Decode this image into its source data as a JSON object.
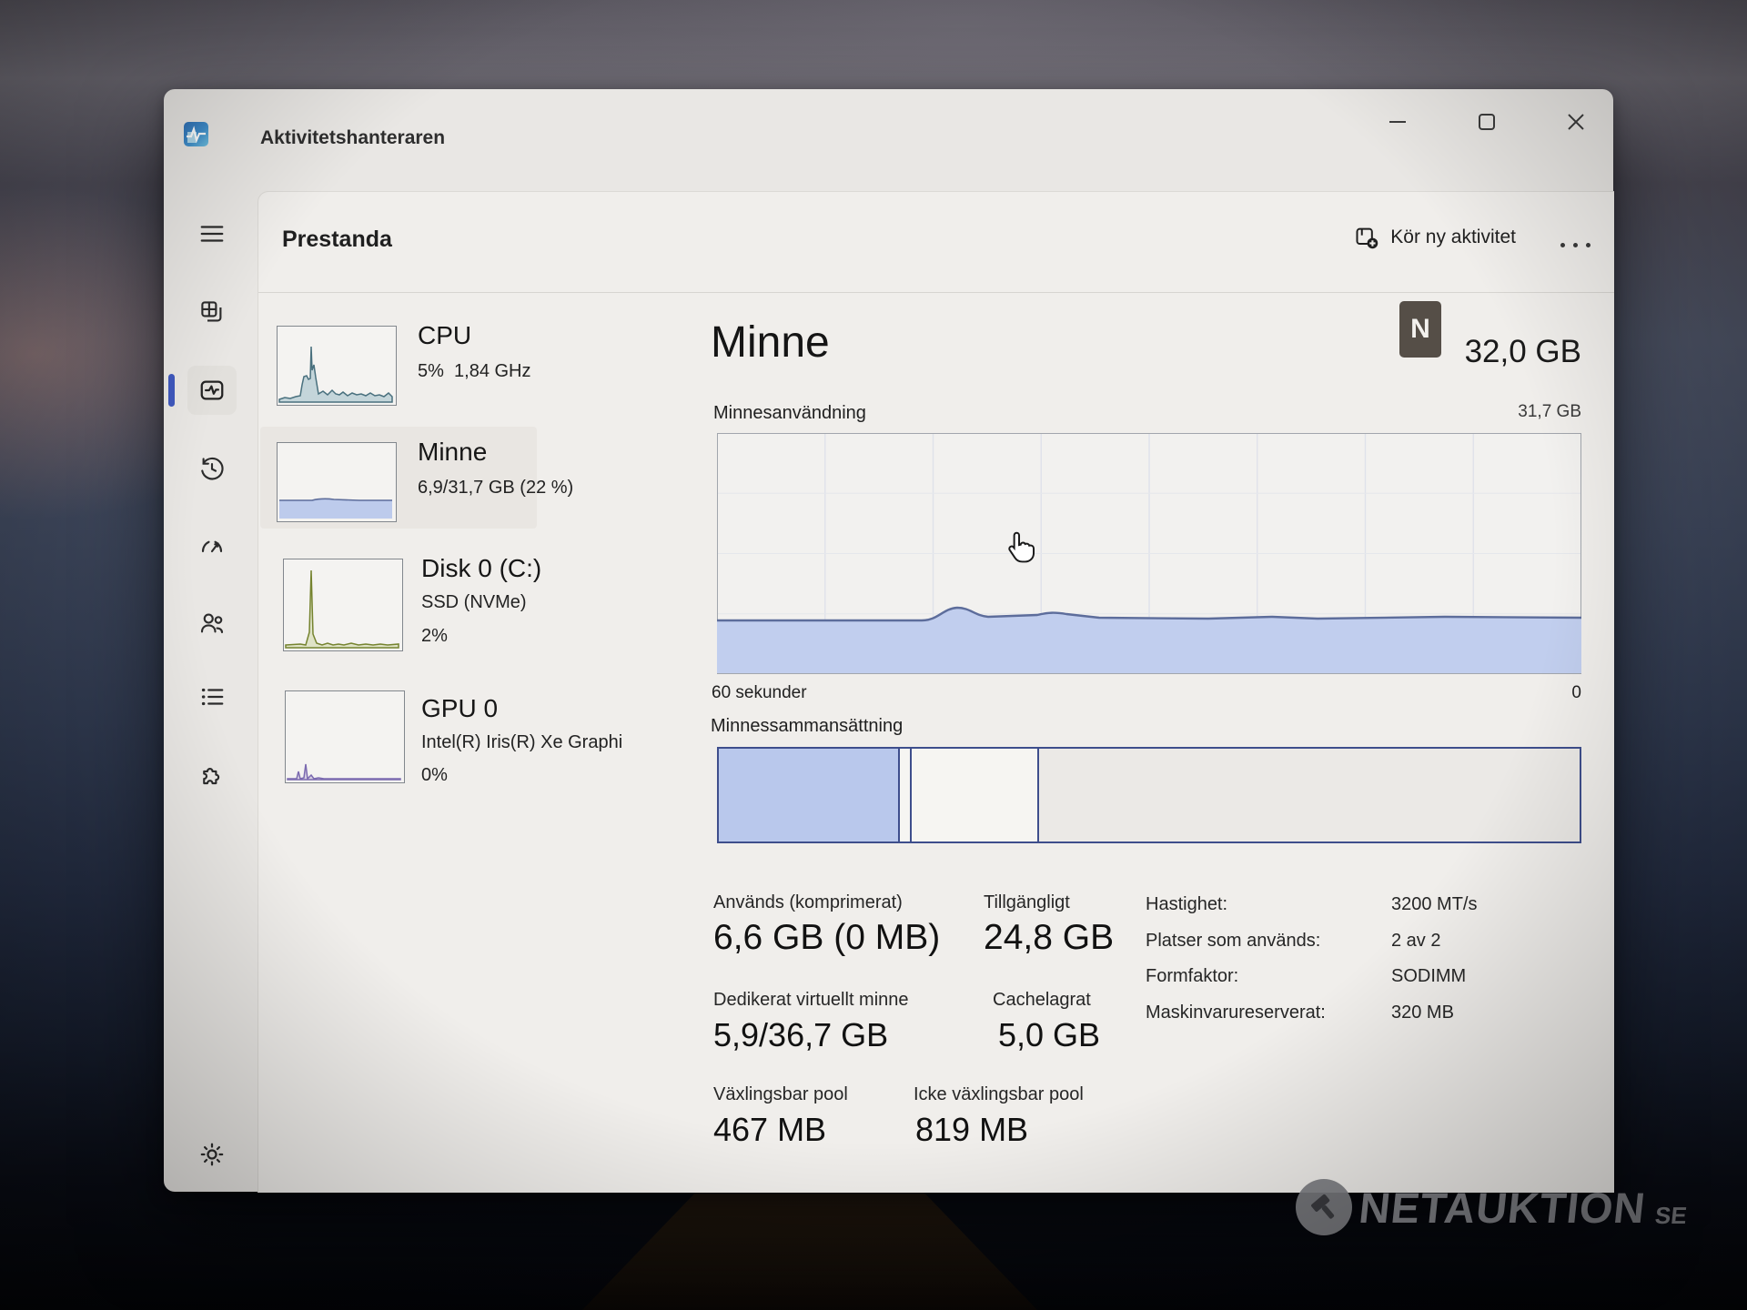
{
  "colors": {
    "accent_blue": "#3f58bd",
    "memory_fill": "#bdcbec",
    "memory_line": "#5d6d9b",
    "cpu_line": "#49707e",
    "disk_line": "#75832f",
    "gpu_line": "#7b6ab0",
    "composition_border": "#3e4e8c",
    "window_bg": "#e9e7e4"
  },
  "titlebar": {
    "title": "Aktivitetshanteraren"
  },
  "sidebar": {
    "items": [
      {
        "icon": "menu-icon"
      },
      {
        "icon": "processes-icon"
      },
      {
        "icon": "performance-icon",
        "selected": true
      },
      {
        "icon": "app-history-icon"
      },
      {
        "icon": "startup-apps-icon"
      },
      {
        "icon": "users-icon"
      },
      {
        "icon": "details-icon"
      },
      {
        "icon": "services-icon"
      },
      {
        "icon": "settings-icon"
      }
    ]
  },
  "panel": {
    "title": "Prestanda",
    "run_new_task": "Kör ny aktivitet"
  },
  "perf_items": [
    {
      "title": "CPU",
      "line1": "5%  1,84 GHz",
      "line2": ""
    },
    {
      "title": "Minne",
      "line1": "6,9/31,7 GB (22 %)",
      "line2": ""
    },
    {
      "title": "Disk 0 (C:)",
      "line1": "SSD (NVMe)",
      "line2": "2%"
    },
    {
      "title": "GPU 0",
      "line1": "Intel(R) Iris(R) Xe Graphi",
      "line2": "0%"
    }
  ],
  "memory": {
    "title": "Minne",
    "access_key_badge": "N",
    "total": "32,0 GB",
    "usage_chart_label": "Minnesanvändning",
    "scale_max": "31,7 GB",
    "x_axis_left": "60 sekunder",
    "x_axis_right": "0",
    "usage_percent_of_chart": 22,
    "composition_label": "Minnessammansättning",
    "stats": [
      {
        "label": "Används (komprimerat)",
        "value": "6,6 GB (0 MB)"
      },
      {
        "label": "Tillgängligt",
        "value": "24,8 GB"
      },
      {
        "label": "Dedikerat virtuellt minne",
        "value": "5,9/36,7 GB"
      },
      {
        "label": "Cachelagrat",
        "value": "5,0 GB"
      },
      {
        "label": "Växlingsbar pool",
        "value": "467 MB"
      },
      {
        "label": "Icke växlingsbar pool",
        "value": "819 MB"
      }
    ],
    "details": [
      {
        "label": "Hastighet:",
        "value": "3200 MT/s"
      },
      {
        "label": "Platser som används:",
        "value": "2 av 2"
      },
      {
        "label": "Formfaktor:",
        "value": "SODIMM"
      },
      {
        "label": "Maskinvarureserverat:",
        "value": "320 MB"
      }
    ]
  },
  "watermark": {
    "brand": "NETAUKTION",
    "tld": "SE"
  }
}
